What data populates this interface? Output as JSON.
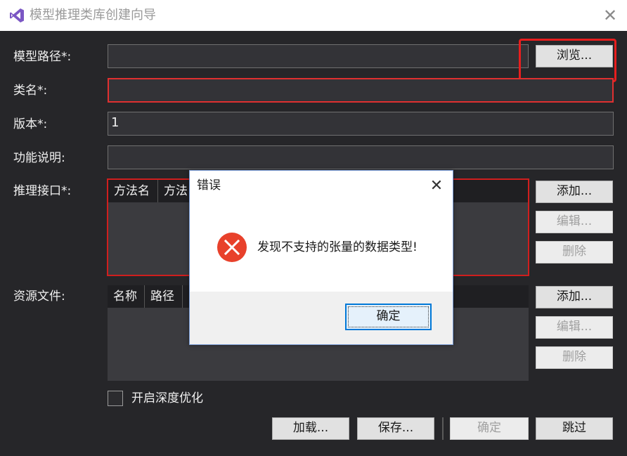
{
  "window": {
    "title": "模型推理类库创建向导",
    "icon": "visual-studio-icon"
  },
  "form": {
    "model_path": {
      "label": "模型路径*:",
      "value": "",
      "browse_label": "浏览..."
    },
    "class_name": {
      "label": "类名*:",
      "value": ""
    },
    "version": {
      "label": "版本*:",
      "value": "1"
    },
    "description": {
      "label": "功能说明:",
      "value": ""
    },
    "inference_interface": {
      "label": "推理接口*:",
      "columns": [
        "方法名",
        "方法"
      ],
      "add_label": "添加...",
      "edit_label": "编辑...",
      "delete_label": "删除"
    },
    "resource_files": {
      "label": "资源文件:",
      "columns": [
        "名称",
        "路径"
      ],
      "add_label": "添加...",
      "edit_label": "编辑...",
      "delete_label": "删除"
    },
    "deep_optimize": {
      "label": "开启深度优化",
      "checked": false
    }
  },
  "footer": {
    "load_label": "加载...",
    "save_label": "保存...",
    "ok_label": "确定",
    "skip_label": "跳过"
  },
  "error_dialog": {
    "title": "错误",
    "message": "发现不支持的张量的数据类型!",
    "ok_label": "确定",
    "icon": "error-icon"
  },
  "colors": {
    "error_red": "#e81e1e",
    "dialog_accent": "#0078d7"
  }
}
